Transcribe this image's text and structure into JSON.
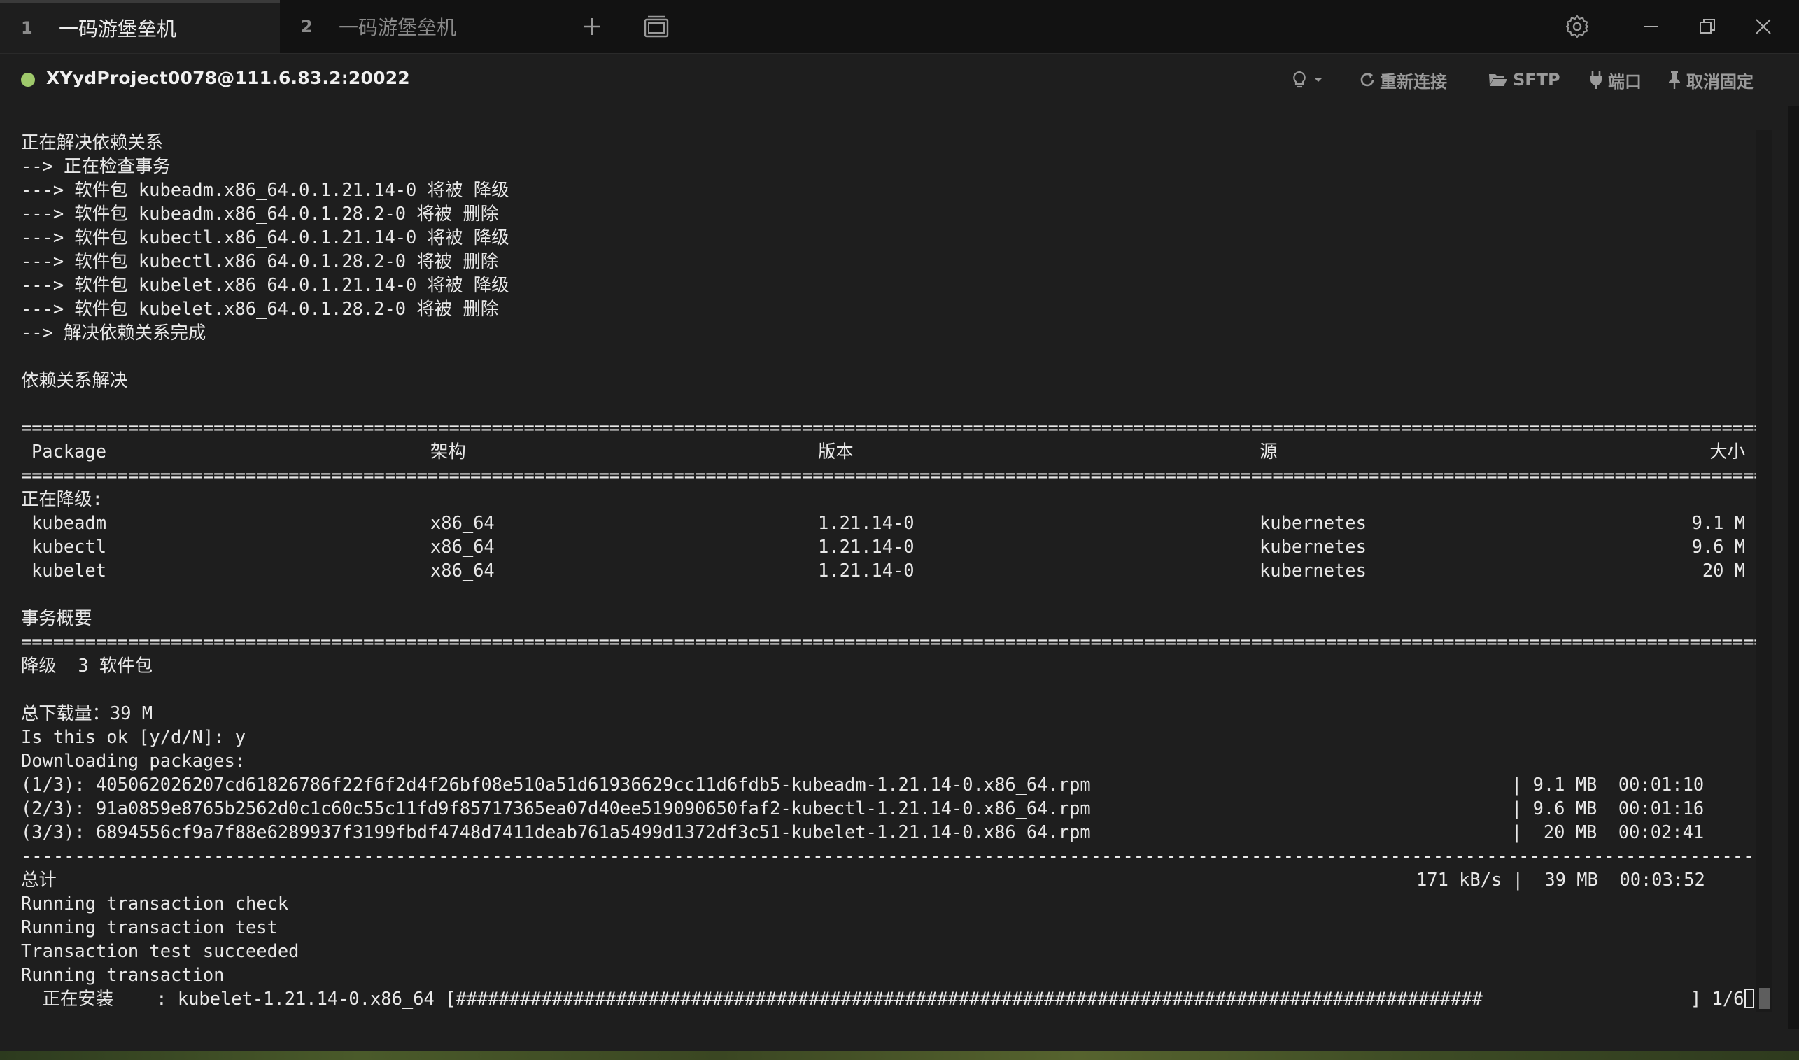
{
  "tabs": [
    {
      "num": "1",
      "label": "一码游堡垒机"
    },
    {
      "num": "2",
      "label": "一码游堡垒机"
    }
  ],
  "window_icons": [
    "add-tab-icon",
    "window-list-icon",
    "gear-icon",
    "minimize-icon",
    "restore-icon",
    "close-icon"
  ],
  "session": {
    "host": "XYydProject0078@111.6.83.2:20022",
    "status_color": "#9fc96b",
    "actions": {
      "reconnect": "重新连接",
      "sftp": "SFTP",
      "port": "端口",
      "unpin": "取消固定"
    }
  },
  "terminal": {
    "lines_top": [
      "正在解决依赖关系",
      "--> 正在检查事务",
      "---> 软件包 kubeadm.x86_64.0.1.21.14-0 将被 降级",
      "---> 软件包 kubeadm.x86_64.0.1.28.2-0 将被 删除",
      "---> 软件包 kubectl.x86_64.0.1.21.14-0 将被 降级",
      "---> 软件包 kubectl.x86_64.0.1.28.2-0 将被 删除",
      "---> 软件包 kubelet.x86_64.0.1.21.14-0 将被 降级",
      "---> 软件包 kubelet.x86_64.0.1.28.2-0 将被 删除",
      "--> 解决依赖关系完成",
      "",
      "依赖关系解决",
      ""
    ],
    "rule_double": "================================================================================================================================================================================",
    "rule_single": "--------------------------------------------------------------------------------------------------------------------------------------------------------------------------------",
    "table_headers": {
      "package": "Package",
      "arch": "架构",
      "version": "版本",
      "repo": "源",
      "size": "大小"
    },
    "downgrading_label": "正在降级:",
    "packages": [
      {
        "name": "kubeadm",
        "arch": "x86_64",
        "version": "1.21.14-0",
        "repo": "kubernetes",
        "size": "9.1 M"
      },
      {
        "name": "kubectl",
        "arch": "x86_64",
        "version": "1.21.14-0",
        "repo": "kubernetes",
        "size": "9.6 M"
      },
      {
        "name": "kubelet",
        "arch": "x86_64",
        "version": "1.21.14-0",
        "repo": "kubernetes",
        "size": "20 M"
      }
    ],
    "summary_title": "事务概要",
    "summary_line": "降级  3 软件包",
    "total_download": "总下载量：39 M",
    "prompt_line": "Is this ok [y/d/N]: y",
    "downloading": "Downloading packages:",
    "downloads": [
      {
        "file": "(1/3): 405062026207cd61826786f22f6f2d4f26bf08e510a51d61936629cc11d6fdb5-kubeadm-1.21.14-0.x86_64.rpm",
        "stat": "| 9.1 MB  00:01:10"
      },
      {
        "file": "(2/3): 91a0859e8765b2562d0c1c60c55c11fd9f85717365ea07d40ee519090650faf2-kubectl-1.21.14-0.x86_64.rpm",
        "stat": "| 9.6 MB  00:01:16"
      },
      {
        "file": "(3/3): 6894556cf9a7f88e6289937f3199fbdf4748d7411deab761a5499d1372df3c51-kubelet-1.21.14-0.x86_64.rpm",
        "stat": "|  20 MB  00:02:41"
      }
    ],
    "total_label": "总计",
    "total_stat": "171 kB/s |  39 MB  00:03:52",
    "lines_after": [
      "Running transaction check",
      "Running transaction test",
      "Transaction test succeeded",
      "Running transaction"
    ],
    "install_line": "  正在安装    : kubelet-1.21.14-0.x86_64 [################################################################################################",
    "install_progress": "] 1/6"
  }
}
